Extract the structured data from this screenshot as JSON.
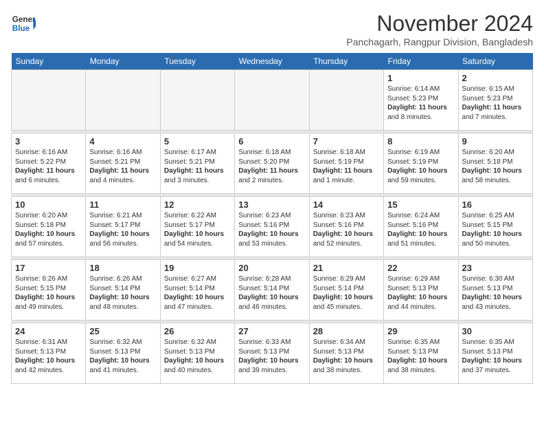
{
  "logo": {
    "line1": "General",
    "line2": "Blue"
  },
  "title": "November 2024",
  "location": "Panchagarh, Rangpur Division, Bangladesh",
  "weekdays": [
    "Sunday",
    "Monday",
    "Tuesday",
    "Wednesday",
    "Thursday",
    "Friday",
    "Saturday"
  ],
  "weeks": [
    [
      {
        "day": "",
        "info": ""
      },
      {
        "day": "",
        "info": ""
      },
      {
        "day": "",
        "info": ""
      },
      {
        "day": "",
        "info": ""
      },
      {
        "day": "",
        "info": ""
      },
      {
        "day": "1",
        "info": "Sunrise: 6:14 AM\nSunset: 5:23 PM\nDaylight: 11 hours\nand 8 minutes."
      },
      {
        "day": "2",
        "info": "Sunrise: 6:15 AM\nSunset: 5:23 PM\nDaylight: 11 hours\nand 7 minutes."
      }
    ],
    [
      {
        "day": "3",
        "info": "Sunrise: 6:16 AM\nSunset: 5:22 PM\nDaylight: 11 hours\nand 6 minutes."
      },
      {
        "day": "4",
        "info": "Sunrise: 6:16 AM\nSunset: 5:21 PM\nDaylight: 11 hours\nand 4 minutes."
      },
      {
        "day": "5",
        "info": "Sunrise: 6:17 AM\nSunset: 5:21 PM\nDaylight: 11 hours\nand 3 minutes."
      },
      {
        "day": "6",
        "info": "Sunrise: 6:18 AM\nSunset: 5:20 PM\nDaylight: 11 hours\nand 2 minutes."
      },
      {
        "day": "7",
        "info": "Sunrise: 6:18 AM\nSunset: 5:19 PM\nDaylight: 11 hours\nand 1 minute."
      },
      {
        "day": "8",
        "info": "Sunrise: 6:19 AM\nSunset: 5:19 PM\nDaylight: 10 hours\nand 59 minutes."
      },
      {
        "day": "9",
        "info": "Sunrise: 6:20 AM\nSunset: 5:18 PM\nDaylight: 10 hours\nand 58 minutes."
      }
    ],
    [
      {
        "day": "10",
        "info": "Sunrise: 6:20 AM\nSunset: 5:18 PM\nDaylight: 10 hours\nand 57 minutes."
      },
      {
        "day": "11",
        "info": "Sunrise: 6:21 AM\nSunset: 5:17 PM\nDaylight: 10 hours\nand 56 minutes."
      },
      {
        "day": "12",
        "info": "Sunrise: 6:22 AM\nSunset: 5:17 PM\nDaylight: 10 hours\nand 54 minutes."
      },
      {
        "day": "13",
        "info": "Sunrise: 6:23 AM\nSunset: 5:16 PM\nDaylight: 10 hours\nand 53 minutes."
      },
      {
        "day": "14",
        "info": "Sunrise: 6:23 AM\nSunset: 5:16 PM\nDaylight: 10 hours\nand 52 minutes."
      },
      {
        "day": "15",
        "info": "Sunrise: 6:24 AM\nSunset: 5:16 PM\nDaylight: 10 hours\nand 51 minutes."
      },
      {
        "day": "16",
        "info": "Sunrise: 6:25 AM\nSunset: 5:15 PM\nDaylight: 10 hours\nand 50 minutes."
      }
    ],
    [
      {
        "day": "17",
        "info": "Sunrise: 6:26 AM\nSunset: 5:15 PM\nDaylight: 10 hours\nand 49 minutes."
      },
      {
        "day": "18",
        "info": "Sunrise: 6:26 AM\nSunset: 5:14 PM\nDaylight: 10 hours\nand 48 minutes."
      },
      {
        "day": "19",
        "info": "Sunrise: 6:27 AM\nSunset: 5:14 PM\nDaylight: 10 hours\nand 47 minutes."
      },
      {
        "day": "20",
        "info": "Sunrise: 6:28 AM\nSunset: 5:14 PM\nDaylight: 10 hours\nand 46 minutes."
      },
      {
        "day": "21",
        "info": "Sunrise: 6:29 AM\nSunset: 5:14 PM\nDaylight: 10 hours\nand 45 minutes."
      },
      {
        "day": "22",
        "info": "Sunrise: 6:29 AM\nSunset: 5:13 PM\nDaylight: 10 hours\nand 44 minutes."
      },
      {
        "day": "23",
        "info": "Sunrise: 6:30 AM\nSunset: 5:13 PM\nDaylight: 10 hours\nand 43 minutes."
      }
    ],
    [
      {
        "day": "24",
        "info": "Sunrise: 6:31 AM\nSunset: 5:13 PM\nDaylight: 10 hours\nand 42 minutes."
      },
      {
        "day": "25",
        "info": "Sunrise: 6:32 AM\nSunset: 5:13 PM\nDaylight: 10 hours\nand 41 minutes."
      },
      {
        "day": "26",
        "info": "Sunrise: 6:32 AM\nSunset: 5:13 PM\nDaylight: 10 hours\nand 40 minutes."
      },
      {
        "day": "27",
        "info": "Sunrise: 6:33 AM\nSunset: 5:13 PM\nDaylight: 10 hours\nand 39 minutes."
      },
      {
        "day": "28",
        "info": "Sunrise: 6:34 AM\nSunset: 5:13 PM\nDaylight: 10 hours\nand 38 minutes."
      },
      {
        "day": "29",
        "info": "Sunrise: 6:35 AM\nSunset: 5:13 PM\nDaylight: 10 hours\nand 38 minutes."
      },
      {
        "day": "30",
        "info": "Sunrise: 6:35 AM\nSunset: 5:13 PM\nDaylight: 10 hours\nand 37 minutes."
      }
    ]
  ]
}
